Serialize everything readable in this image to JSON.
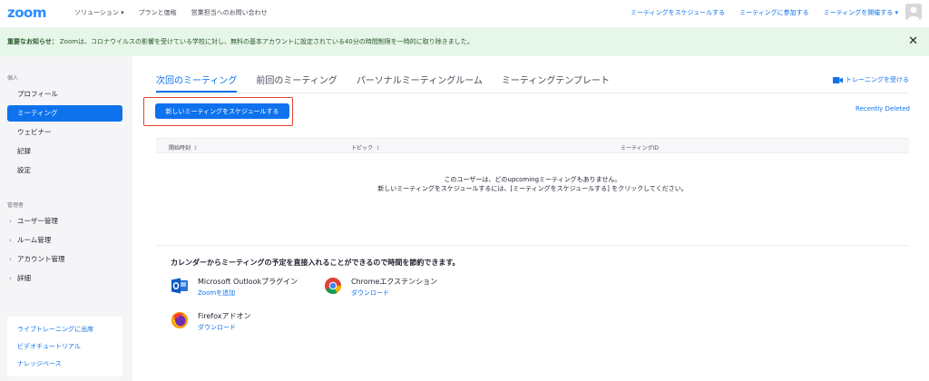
{
  "header": {
    "logo": "zoom",
    "nav_left": [
      "ソリューション ▾",
      "プランと価格",
      "営業担当へのお問い合わせ"
    ],
    "nav_right": [
      "ミーティングをスケジュールする",
      "ミーティングに参加する",
      "ミーティングを開催する ▾"
    ]
  },
  "notice": {
    "label": "重要なお知らせ：",
    "text": "Zoomは、コロナウイルスの影響を受けている学校に対し、無料の基本アカウントに設定されている40分の時間制限を一時的に取り除きました。",
    "close": "✕"
  },
  "sidebar": {
    "section_personal": "個人",
    "personal_items": [
      {
        "label": "プロフィール"
      },
      {
        "label": "ミーティング"
      },
      {
        "label": "ウェビナー"
      },
      {
        "label": "記録"
      },
      {
        "label": "設定"
      }
    ],
    "section_admin": "管理者",
    "admin_items": [
      {
        "label": "ユーザー管理"
      },
      {
        "label": "ルーム管理"
      },
      {
        "label": "アカウント管理"
      },
      {
        "label": "詳細"
      }
    ],
    "links": [
      "ライブトレーニングに出席",
      "ビデオチュートリアル",
      "ナレッジベース"
    ]
  },
  "main": {
    "tabs": [
      "次回のミーティング",
      "前回のミーティング",
      "パーソナルミーティングルーム",
      "ミーティングテンプレート"
    ],
    "training": "トレーニングを受ける",
    "schedule_button": "新しいミーティングをスケジュールする",
    "recently_deleted": "Recently Deleted",
    "table_headers": {
      "start": "開始時刻",
      "topic": "トピック",
      "meeting_id": "ミーティングID",
      "sort": "↕"
    },
    "empty_line1": "このユーザーは、どのupcomingミーティングもありません。",
    "empty_line2": "新しいミーティングをスケジュールするには、[ミーティングをスケジュールする] をクリックしてください。",
    "promo_title": "カレンダーからミーティングの予定を直接入れることができるので時間を節約できます。",
    "extensions": [
      {
        "name": "Microsoft Outlookプラグイン",
        "link": "Zoomを追加",
        "icon": "outlook-icon"
      },
      {
        "name": "Chromeエクステンション",
        "link": "ダウンロード",
        "icon": "chrome-icon"
      },
      {
        "name": "Firefoxアドオン",
        "link": "ダウンロード",
        "icon": "firefox-icon"
      }
    ]
  },
  "colors": {
    "accent": "#0E72ED",
    "notice_bg": "#e6f6e8",
    "highlight_border": "#e0442d"
  }
}
